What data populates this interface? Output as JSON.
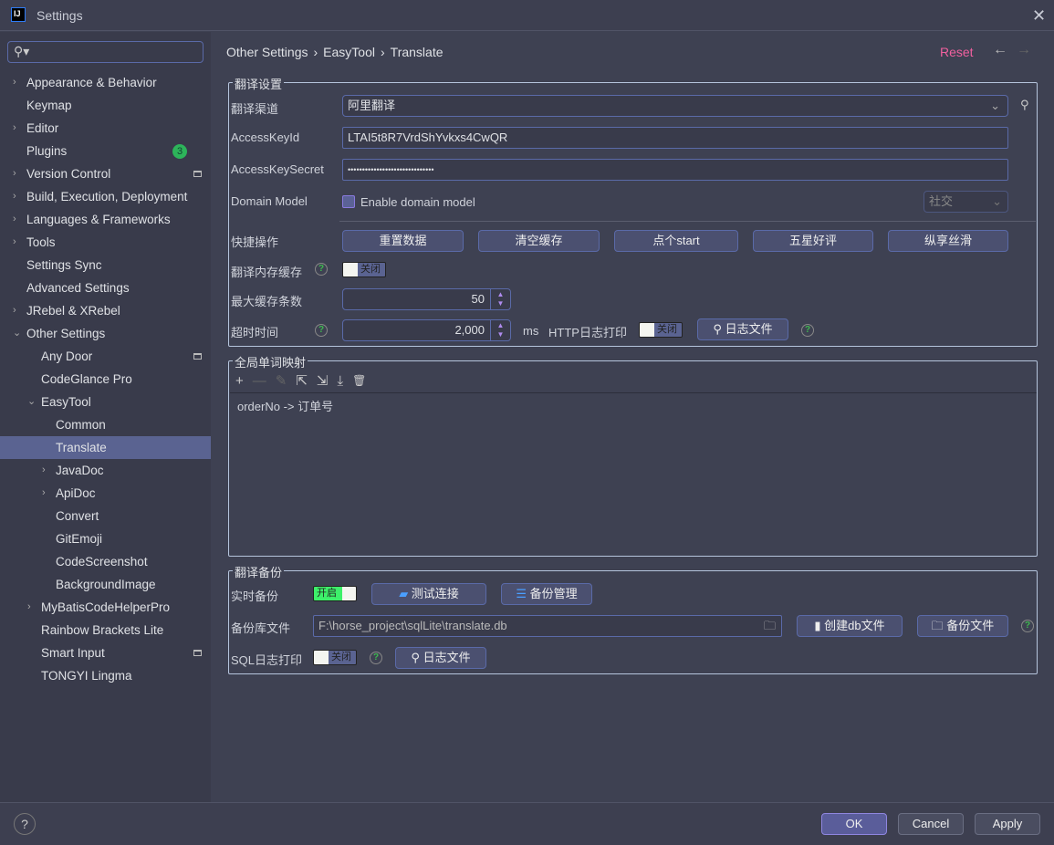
{
  "window": {
    "title": "Settings",
    "logo": "IJ",
    "close": "✕"
  },
  "search": {
    "placeholder": "",
    "icon": "search-icon"
  },
  "sidebar": {
    "items": [
      {
        "label": "Appearance & Behavior",
        "level": 0,
        "arrow": "›"
      },
      {
        "label": "Keymap",
        "level": 0
      },
      {
        "label": "Editor",
        "level": 0,
        "arrow": "›"
      },
      {
        "label": "Plugins",
        "level": 0,
        "badge": "3"
      },
      {
        "label": "Version Control",
        "level": 0,
        "arrow": "›",
        "icon": true
      },
      {
        "label": "Build, Execution, Deployment",
        "level": 0,
        "arrow": "›"
      },
      {
        "label": "Languages & Frameworks",
        "level": 0,
        "arrow": "›"
      },
      {
        "label": "Tools",
        "level": 0,
        "arrow": "›"
      },
      {
        "label": "Settings Sync",
        "level": 0
      },
      {
        "label": "Advanced Settings",
        "level": 0
      },
      {
        "label": "JRebel & XRebel",
        "level": 0,
        "arrow": "›"
      },
      {
        "label": "Other Settings",
        "level": 0,
        "arrow": "⌄"
      },
      {
        "label": "Any Door",
        "level": 1,
        "icon": true
      },
      {
        "label": "CodeGlance Pro",
        "level": 1
      },
      {
        "label": "EasyTool",
        "level": 1,
        "arrow": "⌄"
      },
      {
        "label": "Common",
        "level": 2
      },
      {
        "label": "Translate",
        "level": 2,
        "selected": true
      },
      {
        "label": "JavaDoc",
        "level": 2,
        "arrow": "›"
      },
      {
        "label": "ApiDoc",
        "level": 2,
        "arrow": "›"
      },
      {
        "label": "Convert",
        "level": 2
      },
      {
        "label": "GitEmoji",
        "level": 2
      },
      {
        "label": "CodeScreenshot",
        "level": 2
      },
      {
        "label": "BackgroundImage",
        "level": 2
      },
      {
        "label": "MyBatisCodeHelperPro",
        "level": 1,
        "arrow": "›"
      },
      {
        "label": "Rainbow Brackets Lite",
        "level": 1
      },
      {
        "label": "Smart Input",
        "level": 1,
        "icon": true
      },
      {
        "label": "TONGYI Lingma",
        "level": 1
      }
    ]
  },
  "breadcrumb": [
    "Other Settings",
    "›",
    "EasyTool",
    "›",
    "Translate"
  ],
  "header": {
    "reset": "Reset",
    "back": "←",
    "forward": "→"
  },
  "translate": {
    "title": "翻译设置",
    "channel_label": "翻译渠道",
    "channel_value": "阿里翻译",
    "access_key_id_label": "AccessKeyId",
    "access_key_id": "LTAI5t8R7VrdShYvkxs4CwQR",
    "access_key_secret_label": "AccessKeySecret",
    "access_key_secret": "••••••••••••••••••••••••••••••",
    "domain_label": "Domain Model",
    "domain_checkbox": "Enable domain model",
    "domain_select": "社交",
    "quick_label": "快捷操作",
    "quick_buttons": [
      "重置数据",
      "清空缓存",
      "点个start",
      "五星好评",
      "纵享丝滑"
    ],
    "memcache_label": "翻译内存缓存",
    "memcache_toggle": "关闭",
    "max_cache_label": "最大缓存条数",
    "max_cache": "50",
    "timeout_label": "超时时间",
    "timeout": "2,000",
    "timeout_unit": "ms",
    "http_log_label": "HTTP日志打印",
    "http_log_toggle": "关闭",
    "log_file_button": "日志文件"
  },
  "mapping": {
    "title": "全局单词映射",
    "toolbar": {
      "add": "+",
      "remove": "—",
      "edit": "✎",
      "export": "⇱",
      "import": "⇲",
      "download": "⤓",
      "delete": "🗑"
    },
    "rows": [
      "orderNo -> 订单号"
    ]
  },
  "backup": {
    "title": "翻译备份",
    "realtime_label": "实时备份",
    "realtime_toggle": "开启",
    "test_button": "测试连接",
    "manage_button": "备份管理",
    "db_label": "备份库文件",
    "db_path": "F:\\horse_project\\sqlLite\\translate.db",
    "create_db_button": "创建db文件",
    "backup_file_button": "备份文件",
    "sql_log_label": "SQL日志打印",
    "sql_log_toggle": "关闭",
    "sql_log_file_button": "日志文件"
  },
  "footer": {
    "help": "?",
    "ok": "OK",
    "cancel": "Cancel",
    "apply": "Apply"
  },
  "colors": {
    "accent": "#5a6391",
    "reset": "#f0609f",
    "badge": "#2db45a",
    "toggle_on": "#3df06a"
  }
}
